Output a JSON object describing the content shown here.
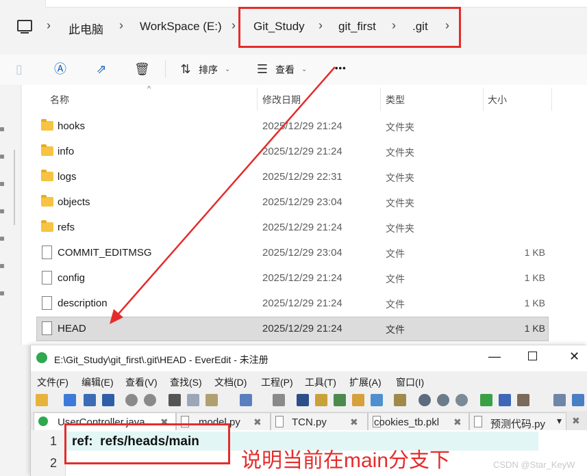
{
  "address_bar": {
    "crumbs": [
      "此电脑",
      "WorkSpace (E:)",
      "Git_Study",
      "git_first",
      ".git"
    ]
  },
  "toolbar": {
    "sort_label": "排序",
    "view_label": "查看",
    "more": "•••"
  },
  "columns": {
    "name": "名称",
    "modified": "修改日期",
    "type": "类型",
    "size": "大小"
  },
  "files": [
    {
      "name": "hooks",
      "modified": "2025/12/29 21:24",
      "type": "文件夹",
      "size": "",
      "kind": "folder"
    },
    {
      "name": "info",
      "modified": "2025/12/29 21:24",
      "type": "文件夹",
      "size": "",
      "kind": "folder"
    },
    {
      "name": "logs",
      "modified": "2025/12/29 22:31",
      "type": "文件夹",
      "size": "",
      "kind": "folder"
    },
    {
      "name": "objects",
      "modified": "2025/12/29 23:04",
      "type": "文件夹",
      "size": "",
      "kind": "folder"
    },
    {
      "name": "refs",
      "modified": "2025/12/29 21:24",
      "type": "文件夹",
      "size": "",
      "kind": "folder"
    },
    {
      "name": "COMMIT_EDITMSG",
      "modified": "2025/12/29 23:04",
      "type": "文件",
      "size": "1 KB",
      "kind": "file"
    },
    {
      "name": "config",
      "modified": "2025/12/29 21:24",
      "type": "文件",
      "size": "1 KB",
      "kind": "file"
    },
    {
      "name": "description",
      "modified": "2025/12/29 21:24",
      "type": "文件",
      "size": "1 KB",
      "kind": "file"
    },
    {
      "name": "HEAD",
      "modified": "2025/12/29 21:24",
      "type": "文件",
      "size": "1 KB",
      "kind": "file",
      "selected": true
    }
  ],
  "everedit": {
    "title": "E:\\Git_Study\\git_first\\.git\\HEAD - EverEdit - 未注册",
    "menu": [
      "文件(F)",
      "编辑(E)",
      "查看(V)",
      "查找(S)",
      "文档(D)",
      "工程(P)",
      "工具(T)",
      "扩展(A)",
      "窗口(I)"
    ],
    "tabs": [
      "UserController.java",
      "model.py",
      "TCN.py",
      "cookies_tb.pkl",
      "预测代码.py"
    ],
    "lines": [
      "ref:  refs/heads/main",
      ""
    ],
    "line_numbers": [
      "1",
      "2"
    ]
  },
  "annotation": {
    "note": "说明当前在main分支下",
    "color": "#e52b2b"
  },
  "watermark": "CSDN @Star_KeyW"
}
